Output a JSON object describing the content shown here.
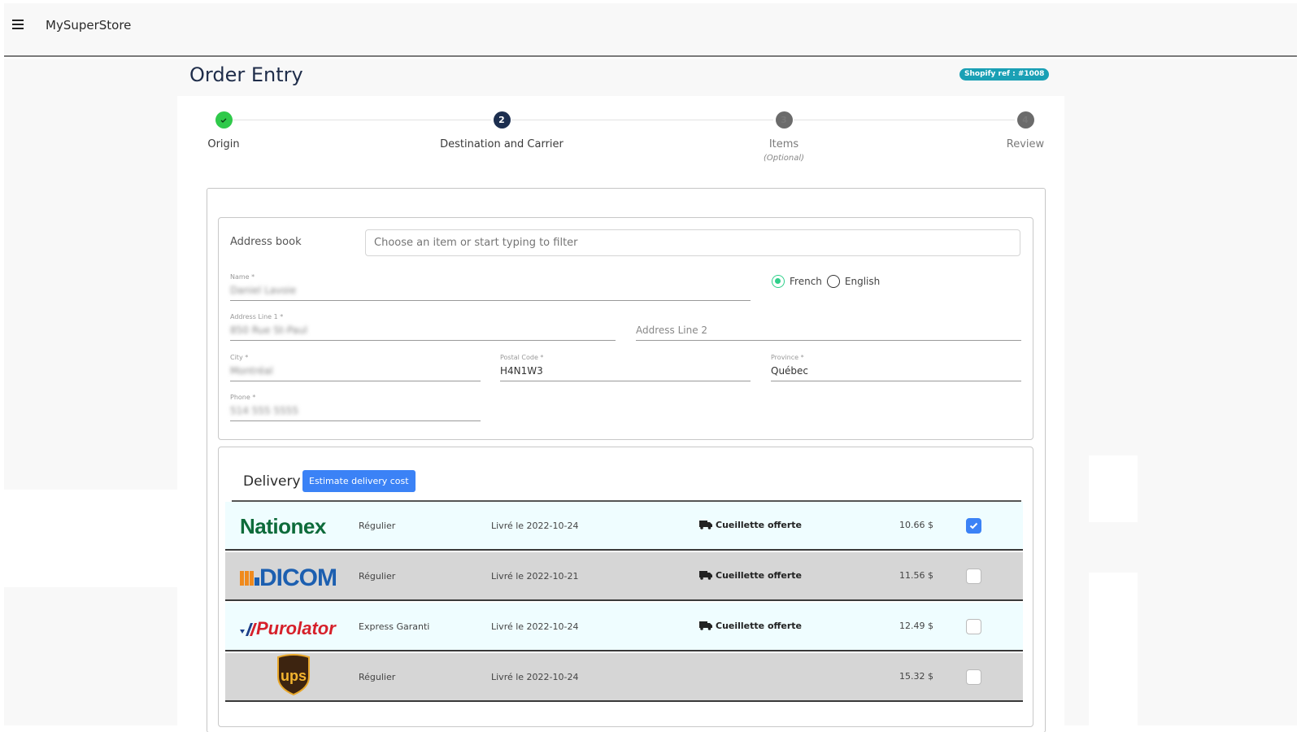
{
  "topbar": {
    "brand": "MySuperStore",
    "menu_icon": "hamburger-icon"
  },
  "page": {
    "title": "Order Entry",
    "badge": "Shopify ref : #1008"
  },
  "stepper": {
    "steps": [
      {
        "label": "Origin",
        "number": "1",
        "state": "done",
        "icon": "check-icon"
      },
      {
        "label": "Destination and Carrier",
        "number": "2",
        "state": "active"
      },
      {
        "label": "Items",
        "sub": "(Optional)",
        "number": "3",
        "state": "pending"
      },
      {
        "label": "Review",
        "number": "4",
        "state": "pending"
      }
    ]
  },
  "address": {
    "address_book_label": "Address book",
    "address_book_placeholder": "Choose an item or start typing to filter",
    "name": {
      "label": "Name *",
      "value": "Daniel Lavoie"
    },
    "line1": {
      "label": "Address Line 1 *",
      "value": "850 Rue St-Paul"
    },
    "line2": {
      "placeholder": "Address Line 2"
    },
    "city": {
      "label": "City *",
      "value": "Montréal"
    },
    "postal": {
      "label": "Postal Code *",
      "value": "H4N1W3"
    },
    "province": {
      "label": "Province *",
      "value": "Québec"
    },
    "phone": {
      "label": "Phone *",
      "value": "514 555 5555"
    },
    "language": {
      "options": [
        "French",
        "English"
      ],
      "selected": "French"
    }
  },
  "delivery": {
    "title": "Delivery",
    "estimate_button": "Estimate delivery cost",
    "carriers": [
      {
        "name": "Nationex",
        "service": "Régulier",
        "eta": "Livré le 2022-10-24",
        "pickup": "Cueillette offerte",
        "price": "10.66 $",
        "selected": true
      },
      {
        "name": "Dicom",
        "service": "Régulier",
        "eta": "Livré le 2022-10-21",
        "pickup": "Cueillette offerte",
        "price": "11.56 $",
        "selected": false
      },
      {
        "name": "Purolator",
        "service": "Express Garanti",
        "eta": "Livré le 2022-10-24",
        "pickup": "Cueillette offerte",
        "price": "12.49 $",
        "selected": false
      },
      {
        "name": "UPS",
        "service": "Régulier",
        "eta": "Livré le 2022-10-24",
        "pickup": "",
        "price": "15.32 $",
        "selected": false
      }
    ]
  },
  "colors": {
    "accent_blue": "#3b82f6",
    "badge_teal": "#1aa0b5",
    "step_done": "#2fc94a",
    "step_active": "#1c2e4f",
    "radio_green": "#2fcf8a",
    "row_light": "#effdff",
    "row_dark": "#d6d6d6"
  }
}
